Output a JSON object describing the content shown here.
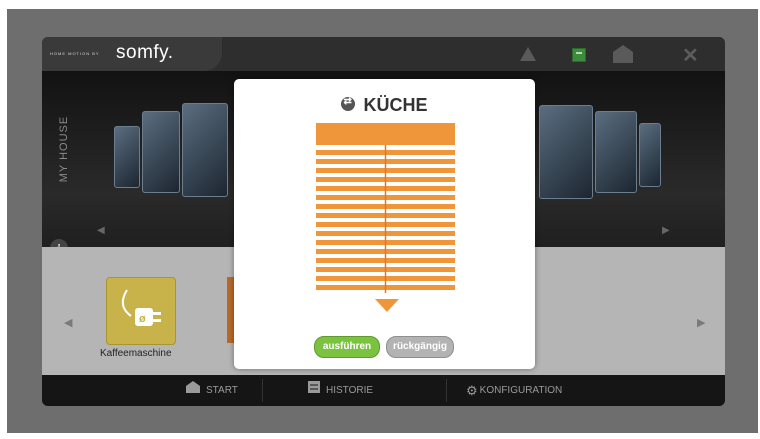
{
  "header": {
    "brand_tagline": "HOME MOTION BY",
    "brand": "somfy."
  },
  "house": {
    "label": "MY HOUSE"
  },
  "devices": {
    "items": [
      {
        "label": "Kaffeemaschine"
      }
    ]
  },
  "nav": [
    {
      "label": "START",
      "icon": "home-icon"
    },
    {
      "label": "HISTORIE",
      "icon": "history-icon"
    },
    {
      "label": "KONFIGURATION",
      "icon": "gear-icon"
    }
  ],
  "modal": {
    "title": "KÜCHE",
    "execute_label": "ausführen",
    "undo_label": "rückgängig"
  },
  "colors": {
    "accent": "#f0963a",
    "execute": "#7cc241",
    "undo": "#b3b3b3"
  }
}
